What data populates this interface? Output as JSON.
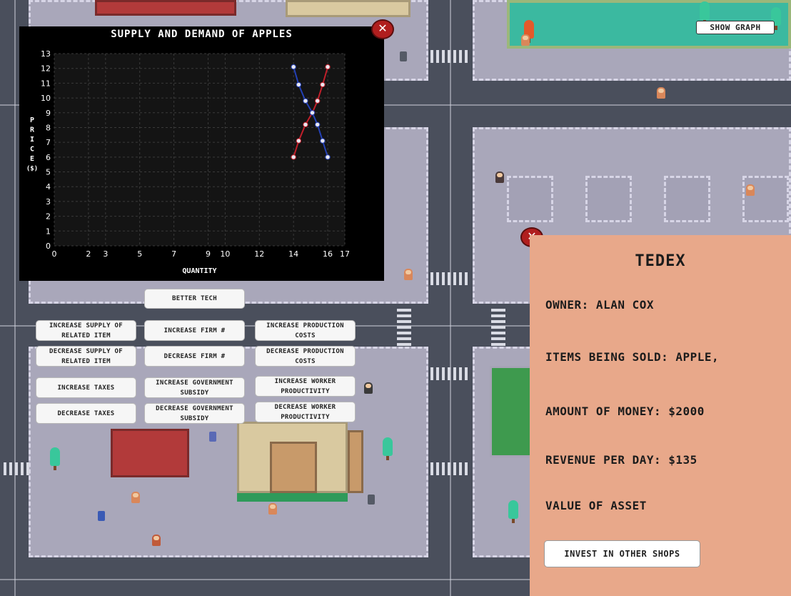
{
  "chart_data": {
    "type": "line",
    "title": "SUPPLY AND DEMAND OF APPLES",
    "xlabel": "QUANTITY",
    "ylabel": "PRICE ($)",
    "x_ticks": [
      0,
      2,
      3,
      5,
      7,
      9,
      10,
      12,
      14,
      16,
      17
    ],
    "y_ticks": [
      0,
      1,
      2,
      3,
      4,
      5,
      6,
      7,
      8,
      9,
      10,
      11,
      12,
      13
    ],
    "xlim": [
      0,
      17
    ],
    "ylim": [
      0,
      13
    ],
    "grid": true,
    "series": [
      {
        "color": "#c21f2a",
        "points": [
          [
            14.0,
            6.0
          ],
          [
            14.3,
            7.1
          ],
          [
            14.7,
            8.2
          ],
          [
            15.1,
            9.0
          ],
          [
            15.4,
            9.8
          ],
          [
            15.7,
            10.9
          ],
          [
            16.0,
            12.1
          ]
        ]
      },
      {
        "color": "#2340b5",
        "points": [
          [
            14.0,
            12.1
          ],
          [
            14.3,
            10.9
          ],
          [
            14.7,
            9.8
          ],
          [
            15.1,
            9.0
          ],
          [
            15.4,
            8.2
          ],
          [
            15.7,
            7.1
          ],
          [
            16.0,
            6.0
          ]
        ]
      }
    ]
  },
  "chart_panel": {
    "close_icon": "close-x-icon"
  },
  "controls": {
    "better_tech": "BETTER TECH",
    "increase_supply_related": "INCREASE SUPPLY OF RELATED ITEM",
    "decrease_supply_related": "DECREASE SUPPLY OF RELATED ITEM",
    "increase_taxes": "INCREASE TAXES",
    "decrease_taxes": "DECREASE TAXES",
    "increase_firm": "INCREASE FIRM #",
    "decrease_firm": "DECREASE FIRM #",
    "increase_subsidy": "INCREASE GOVERNMENT SUBSIDY",
    "decrease_subsidy": "DECREASE GOVERNMENT SUBSIDY",
    "increase_production_costs": "INCREASE PRODUCTION COSTS",
    "decrease_production_costs": "DECREASE PRODUCTION COSTS",
    "increase_worker_productivity": "INCREASE WORKER PRODUCTIVITY",
    "decrease_worker_productivity": "DECREASE WORKER PRODUCTIVITY"
  },
  "show_graph_label": "SHOW GRAPH",
  "shop": {
    "name": "TEDEX",
    "owner": "OWNER: ALAN COX",
    "items": "ITEMS BEING SOLD: APPLE,",
    "money": "AMOUNT OF MONEY: $2000",
    "revenue": "REVENUE PER DAY: $135",
    "asset": "VALUE OF ASSET",
    "invest_label": "INVEST IN OTHER SHOPS"
  },
  "colors": {
    "panel": "#e8a88a",
    "close": "#b01e1e",
    "map_road": "#4a4f5c",
    "block": "#a9a7ba"
  }
}
